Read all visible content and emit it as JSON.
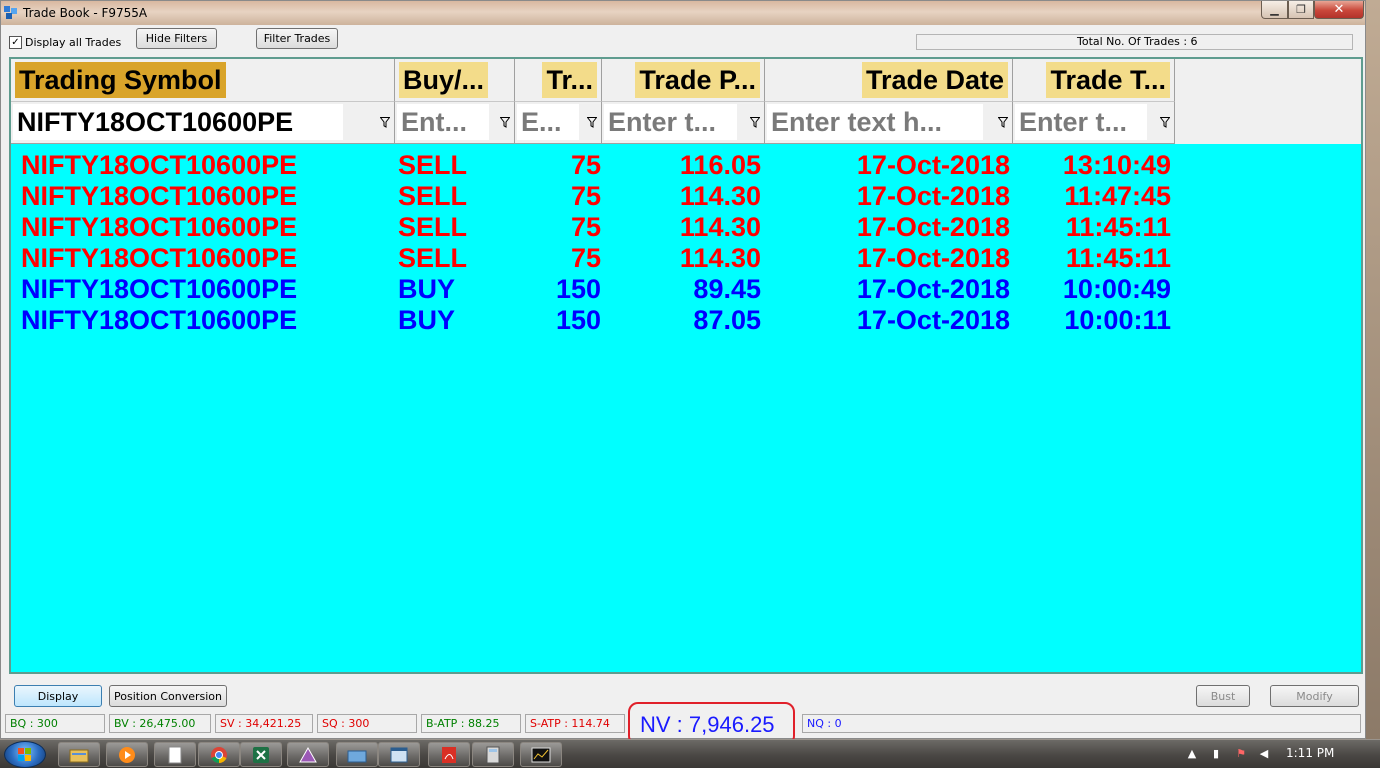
{
  "window": {
    "title": "Trade Book - F9755A",
    "minimize_glyph": "▁",
    "maximize_glyph": "❐",
    "close_glyph": "✕"
  },
  "toolbar": {
    "display_all_label": "Display all Trades",
    "display_all_checked": true,
    "hide_filters_label": "Hide Filters",
    "filter_trades_label": "Filter Trades",
    "total_trades_text": "Total No. Of Trades : 6"
  },
  "grid": {
    "columns": [
      {
        "label": "Trading Symbol",
        "filter_value": "NIFTY18OCT10600PE",
        "filter_placeholder": ""
      },
      {
        "label": "Buy/...",
        "filter_value": "",
        "filter_placeholder": "Ent..."
      },
      {
        "label": "Tr...",
        "filter_value": "",
        "filter_placeholder": "E..."
      },
      {
        "label": "Trade P...",
        "filter_value": "",
        "filter_placeholder": "Enter t..."
      },
      {
        "label": "Trade Date",
        "filter_value": "",
        "filter_placeholder": "Enter text h..."
      },
      {
        "label": "Trade T...",
        "filter_value": "",
        "filter_placeholder": "Enter t..."
      }
    ],
    "header_color": "#f3dc8a",
    "sorted_header_color": "#d9a42a",
    "background_color": "#00ffff",
    "sell_color": "#ff0000",
    "buy_color": "#0000ff",
    "rows": [
      {
        "symbol": "NIFTY18OCT10600PE",
        "side": "SELL",
        "qty": "75",
        "price": "116.05",
        "date": "17-Oct-2018",
        "time": "13:10:49"
      },
      {
        "symbol": "NIFTY18OCT10600PE",
        "side": "SELL",
        "qty": "75",
        "price": "114.30",
        "date": "17-Oct-2018",
        "time": "11:47:45"
      },
      {
        "symbol": "NIFTY18OCT10600PE",
        "side": "SELL",
        "qty": "75",
        "price": "114.30",
        "date": "17-Oct-2018",
        "time": "11:45:11"
      },
      {
        "symbol": "NIFTY18OCT10600PE",
        "side": "SELL",
        "qty": "75",
        "price": "114.30",
        "date": "17-Oct-2018",
        "time": "11:45:11"
      },
      {
        "symbol": "NIFTY18OCT10600PE",
        "side": "BUY",
        "qty": "150",
        "price": "89.45",
        "date": "17-Oct-2018",
        "time": "10:00:49"
      },
      {
        "symbol": "NIFTY18OCT10600PE",
        "side": "BUY",
        "qty": "150",
        "price": "87.05",
        "date": "17-Oct-2018",
        "time": "10:00:11"
      }
    ]
  },
  "actions": {
    "display_label": "Display",
    "position_conversion_label": "Position Conversion",
    "bust_label": "Bust",
    "modify_label": "Modify"
  },
  "status": {
    "bq": "BQ : 300",
    "bv": "BV : 26,475.00",
    "sv": "SV : 34,421.25",
    "sq": "SQ : 300",
    "batp": "B-ATP : 88.25",
    "satp": "S-ATP : 114.74",
    "nv": "NV : 7,946.25",
    "nq": "NQ : 0",
    "buy_color": "#008000",
    "sell_color": "#e00000",
    "net_color": "#1a1aff"
  },
  "taskbar": {
    "clock": "1:11 PM",
    "apps": [
      "explorer-icon",
      "media-player-icon",
      "document-icon",
      "chrome-icon",
      "excel-icon",
      "app-triangle-icon",
      "folder-icon",
      "window-icon",
      "pdf-icon",
      "calculator-icon",
      "chart-icon"
    ]
  }
}
